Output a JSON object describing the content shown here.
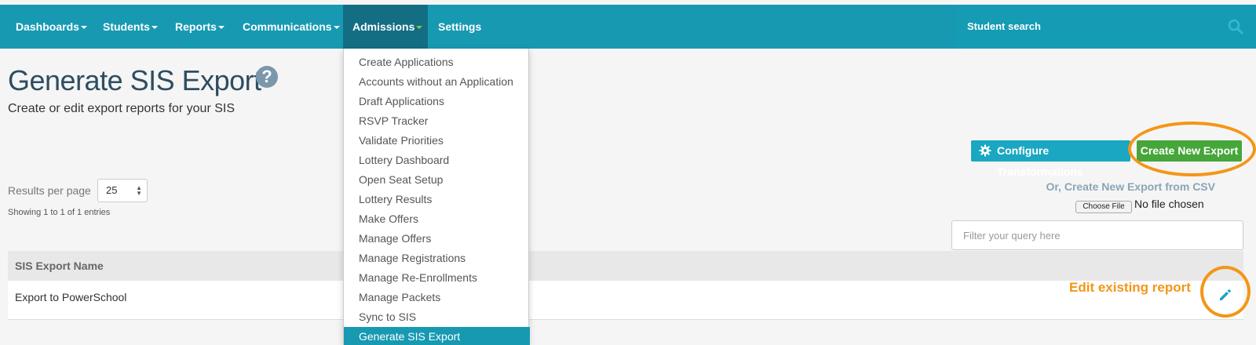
{
  "nav": {
    "items": [
      {
        "label": "Dashboards",
        "dropdown": true
      },
      {
        "label": "Students",
        "dropdown": true
      },
      {
        "label": "Reports",
        "dropdown": true
      },
      {
        "label": "Communications",
        "dropdown": true
      },
      {
        "label": "Admissions",
        "dropdown": true,
        "active": true
      },
      {
        "label": "Settings",
        "dropdown": false
      }
    ],
    "search_label": "Student search",
    "search_icon": "search-icon"
  },
  "page": {
    "title": "Generate SIS Export",
    "help_icon_glyph": "?",
    "subtitle": "Create or edit export reports for your SIS"
  },
  "controls": {
    "results_per_page_label": "Results per page",
    "results_per_page_value": "25",
    "showing_text": "Showing 1 to 1 of 1 entries",
    "configure_button": "Configure Transformations",
    "create_button": "Create New Export",
    "csv_label": "Or, Create New Export from CSV",
    "choose_file_button": "Choose File",
    "no_file_text": "No file chosen",
    "filter_placeholder": "Filter your query here"
  },
  "table": {
    "header": "SIS Export Name",
    "rows": [
      {
        "name": "Export to PowerSchool"
      }
    ]
  },
  "annotations": {
    "edit_note": "Edit existing report",
    "highlight_color": "#f39617"
  },
  "admissions_menu": {
    "items": [
      "Create Applications",
      "Accounts without an Application",
      "Draft Applications",
      "RSVP Tracker",
      "Validate Priorities",
      "Lottery Dashboard",
      "Open Seat Setup",
      "Lottery Results",
      "Make Offers",
      "Manage Offers",
      "Manage Registrations",
      "Manage Re-Enrollments",
      "Manage Packets",
      "Sync to SIS",
      "Generate SIS Export"
    ],
    "active_item": "Generate SIS Export"
  },
  "colors": {
    "topbar": "#1799b2",
    "active_nav": "#136e84",
    "create_button": "#46a63a",
    "configure_button": "#1aa7c2"
  }
}
